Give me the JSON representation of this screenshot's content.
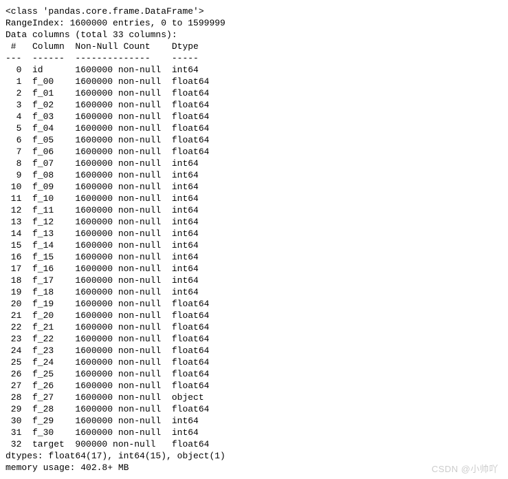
{
  "header": {
    "class_line": "<class 'pandas.core.frame.DataFrame'>",
    "range_index": "RangeIndex: 1600000 entries, 0 to 1599999",
    "data_cols": "Data columns (total 33 columns):",
    "col_headers": " #   Column  Non-Null Count    Dtype  ",
    "divider": "---  ------  --------------    -----  "
  },
  "rows": [
    {
      "i": "0",
      "c": "id",
      "n": "1600000 non-null",
      "d": "int64"
    },
    {
      "i": "1",
      "c": "f_00",
      "n": "1600000 non-null",
      "d": "float64"
    },
    {
      "i": "2",
      "c": "f_01",
      "n": "1600000 non-null",
      "d": "float64"
    },
    {
      "i": "3",
      "c": "f_02",
      "n": "1600000 non-null",
      "d": "float64"
    },
    {
      "i": "4",
      "c": "f_03",
      "n": "1600000 non-null",
      "d": "float64"
    },
    {
      "i": "5",
      "c": "f_04",
      "n": "1600000 non-null",
      "d": "float64"
    },
    {
      "i": "6",
      "c": "f_05",
      "n": "1600000 non-null",
      "d": "float64"
    },
    {
      "i": "7",
      "c": "f_06",
      "n": "1600000 non-null",
      "d": "float64"
    },
    {
      "i": "8",
      "c": "f_07",
      "n": "1600000 non-null",
      "d": "int64"
    },
    {
      "i": "9",
      "c": "f_08",
      "n": "1600000 non-null",
      "d": "int64"
    },
    {
      "i": "10",
      "c": "f_09",
      "n": "1600000 non-null",
      "d": "int64"
    },
    {
      "i": "11",
      "c": "f_10",
      "n": "1600000 non-null",
      "d": "int64"
    },
    {
      "i": "12",
      "c": "f_11",
      "n": "1600000 non-null",
      "d": "int64"
    },
    {
      "i": "13",
      "c": "f_12",
      "n": "1600000 non-null",
      "d": "int64"
    },
    {
      "i": "14",
      "c": "f_13",
      "n": "1600000 non-null",
      "d": "int64"
    },
    {
      "i": "15",
      "c": "f_14",
      "n": "1600000 non-null",
      "d": "int64"
    },
    {
      "i": "16",
      "c": "f_15",
      "n": "1600000 non-null",
      "d": "int64"
    },
    {
      "i": "17",
      "c": "f_16",
      "n": "1600000 non-null",
      "d": "int64"
    },
    {
      "i": "18",
      "c": "f_17",
      "n": "1600000 non-null",
      "d": "int64"
    },
    {
      "i": "19",
      "c": "f_18",
      "n": "1600000 non-null",
      "d": "int64"
    },
    {
      "i": "20",
      "c": "f_19",
      "n": "1600000 non-null",
      "d": "float64"
    },
    {
      "i": "21",
      "c": "f_20",
      "n": "1600000 non-null",
      "d": "float64"
    },
    {
      "i": "22",
      "c": "f_21",
      "n": "1600000 non-null",
      "d": "float64"
    },
    {
      "i": "23",
      "c": "f_22",
      "n": "1600000 non-null",
      "d": "float64"
    },
    {
      "i": "24",
      "c": "f_23",
      "n": "1600000 non-null",
      "d": "float64"
    },
    {
      "i": "25",
      "c": "f_24",
      "n": "1600000 non-null",
      "d": "float64"
    },
    {
      "i": "26",
      "c": "f_25",
      "n": "1600000 non-null",
      "d": "float64"
    },
    {
      "i": "27",
      "c": "f_26",
      "n": "1600000 non-null",
      "d": "float64"
    },
    {
      "i": "28",
      "c": "f_27",
      "n": "1600000 non-null",
      "d": "object"
    },
    {
      "i": "29",
      "c": "f_28",
      "n": "1600000 non-null",
      "d": "float64"
    },
    {
      "i": "30",
      "c": "f_29",
      "n": "1600000 non-null",
      "d": "int64"
    },
    {
      "i": "31",
      "c": "f_30",
      "n": "1600000 non-null",
      "d": "int64"
    },
    {
      "i": "32",
      "c": "target",
      "n": "900000 non-null",
      "d": "float64"
    }
  ],
  "footer": {
    "dtypes": "dtypes: float64(17), int64(15), object(1)",
    "memory": "memory usage: 402.8+ MB"
  },
  "watermark": "CSDN @小帅吖"
}
